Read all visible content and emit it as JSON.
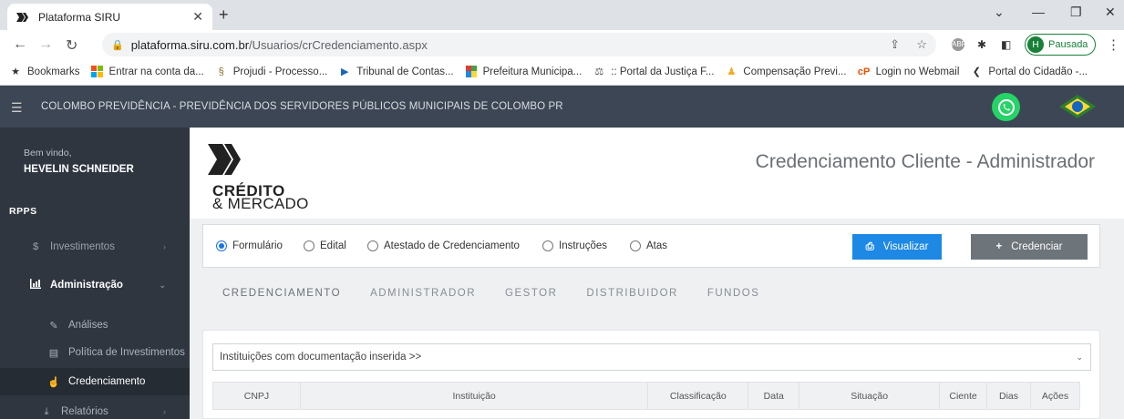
{
  "browser": {
    "tab_title": "Plataforma SIRU",
    "url_host": "plataforma.siru.com.br",
    "url_path": "/Usuarios/crCredenciamento.aspx",
    "profile_initial": "H",
    "profile_status": "Pausada",
    "bookmarks": [
      {
        "label": "Bookmarks",
        "icon": "star-icon"
      },
      {
        "label": "Entrar na conta da...",
        "icon": "microsoft-icon"
      },
      {
        "label": "Projudi - Processo...",
        "icon": "projudi-icon"
      },
      {
        "label": "Tribunal de Contas...",
        "icon": "play-icon"
      },
      {
        "label": "Prefeitura Municipa...",
        "icon": "crest-icon"
      },
      {
        "label": ":: Portal da Justiça F...",
        "icon": "justice-icon"
      },
      {
        "label": "Compensação Previ...",
        "icon": "person-icon"
      },
      {
        "label": "Login no Webmail",
        "icon": "cp-icon"
      },
      {
        "label": "Portal do Cidadão -...",
        "icon": "chevron-left-icon"
      }
    ]
  },
  "app": {
    "title": "COLOMBO PREVIDÊNCIA - PREVIDÊNCIA DOS SERVIDORES PÚBLICOS MUNICIPAIS DE COLOMBO  PR"
  },
  "sidebar": {
    "welcome": "Bem vindo,",
    "user_name": "HEVELIN SCHNEIDER",
    "section": "RPPS",
    "items": [
      {
        "label": "Investimentos",
        "icon": "dollar-icon"
      },
      {
        "label": "Administração",
        "icon": "chart-icon"
      },
      {
        "label": "Análises",
        "icon": "edit-icon"
      },
      {
        "label": "Política de Investimentos",
        "icon": "list-icon"
      },
      {
        "label": "Credenciamento",
        "icon": "thumbs-up-icon"
      },
      {
        "label": "Relatórios",
        "icon": "download-icon"
      }
    ]
  },
  "main": {
    "logo_line1": "CRÉDITO",
    "logo_line2": "& MERCADO",
    "page_title": "Credenciamento Cliente - Administrador",
    "radios": [
      {
        "label": "Formulário",
        "selected": true
      },
      {
        "label": "Edital",
        "selected": false
      },
      {
        "label": "Atestado de Credenciamento",
        "selected": false
      },
      {
        "label": "Instruções",
        "selected": false
      },
      {
        "label": "Atas",
        "selected": false
      }
    ],
    "view_button": "Visualizar",
    "credenciar_button": "Credenciar",
    "tabs": [
      "CREDENCIAMENTO",
      "ADMINISTRADOR",
      "GESTOR",
      "DISTRIBUIDOR",
      "FUNDOS"
    ],
    "select_value": "Instituições com documentação inserida >>",
    "table_headers": [
      "CNPJ",
      "Instituição",
      "Classificação",
      "Data",
      "Situação",
      "Ciente",
      "Dias",
      "Ações"
    ]
  }
}
